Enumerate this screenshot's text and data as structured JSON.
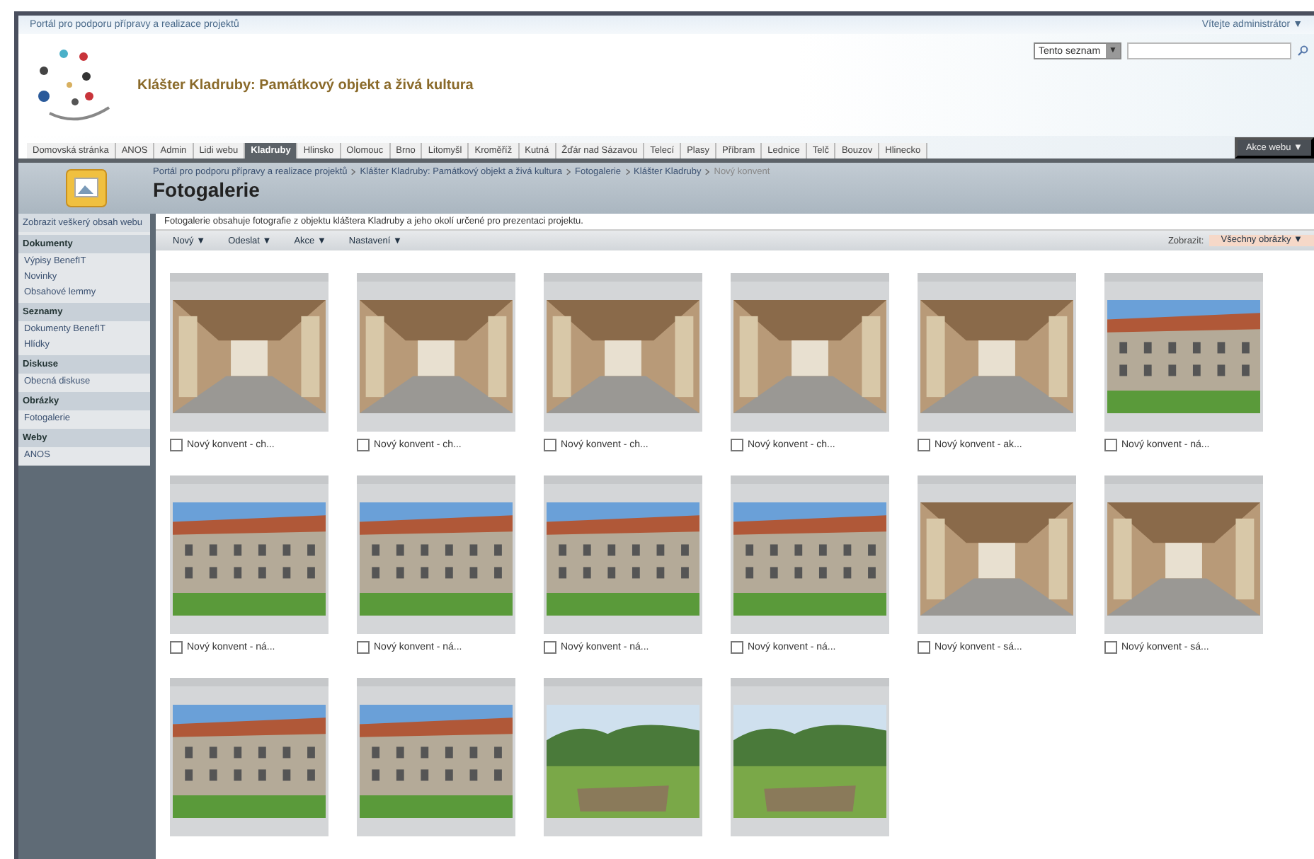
{
  "top_bar": {
    "site": "Portál pro podporu přípravy a realizace projektů",
    "user": "Vítejte administrátor ▼"
  },
  "search": {
    "scope": "Tento seznam",
    "button": "▼"
  },
  "header": {
    "title": "Klášter Kladruby: Památkový objekt a živá kultura"
  },
  "nav": [
    {
      "label": "Domovská stránka",
      "selected": false
    },
    {
      "label": "ANOS",
      "selected": false
    },
    {
      "label": "Admin",
      "selected": false
    },
    {
      "label": "Lidi webu",
      "selected": false
    },
    {
      "label": "Kladruby",
      "selected": true
    },
    {
      "label": "Hlinsko",
      "selected": false
    },
    {
      "label": "Olomouc",
      "selected": false
    },
    {
      "label": "Brno",
      "selected": false
    },
    {
      "label": "Litomyšl",
      "selected": false
    },
    {
      "label": "Kroměříž",
      "selected": false
    },
    {
      "label": "Kutná",
      "selected": false
    },
    {
      "label": "Žďár nad Sázavou",
      "selected": false
    },
    {
      "label": "Telecí",
      "selected": false
    },
    {
      "label": "Plasy",
      "selected": false
    },
    {
      "label": "Příbram",
      "selected": false
    },
    {
      "label": "Lednice",
      "selected": false
    },
    {
      "label": "Telč",
      "selected": false
    },
    {
      "label": "Bouzov",
      "selected": false
    },
    {
      "label": "Hlinecko",
      "selected": false
    }
  ],
  "site_actions": "Akce webu ▼",
  "breadcrumb": [
    "Portál pro podporu přípravy a realizace projektů",
    "Klášter Kladruby: Památkový objekt a živá kultura",
    "Fotogalerie",
    "Klášter Kladruby",
    "Nový konvent"
  ],
  "page_title": "Fotogalerie",
  "description": "Fotogalerie obsahuje fotografie z objektu kláštera Kladruby a jeho okolí určené pro prezentaci projektu.",
  "toolbar": [
    "Nový ▼",
    "Odeslat ▼",
    "Akce ▼",
    "Nastavení ▼"
  ],
  "view": {
    "label": "Zobrazit:",
    "value": "Všechny obrázky ▼"
  },
  "sidebar": {
    "all_content": "Zobrazit veškerý obsah webu",
    "sections": [
      {
        "heading": "Dokumenty",
        "items": [
          "Výpisy BenefIT",
          "Novinky",
          "Obsahové lemmy"
        ]
      },
      {
        "heading": "Seznamy",
        "items": [
          "Dokumenty BenefIT",
          "Hlídky"
        ]
      },
      {
        "heading": "Diskuse",
        "items": [
          "Obecná diskuse"
        ]
      },
      {
        "heading": "Obrázky",
        "items": [
          "Fotogalerie"
        ]
      },
      {
        "heading": "Weby",
        "items": [
          "ANOS"
        ]
      }
    ]
  },
  "photos": [
    {
      "kind": "interior",
      "caption": "Nový konvent - ch...",
      "checked": false
    },
    {
      "kind": "interior",
      "caption": "Nový konvent - ch...",
      "checked": false
    },
    {
      "kind": "interior",
      "caption": "Nový konvent - ch...",
      "checked": false
    },
    {
      "kind": "interior",
      "caption": "Nový konvent - ch...",
      "checked": false
    },
    {
      "kind": "interior",
      "caption": "Nový konvent - ak...",
      "checked": false
    },
    {
      "kind": "courtyard",
      "caption": "Nový konvent - ná...",
      "checked": false
    },
    {
      "kind": "courtyard",
      "caption": "Nový konvent - ná...",
      "checked": false
    },
    {
      "kind": "courtyard",
      "caption": "Nový konvent - ná...",
      "checked": false
    },
    {
      "kind": "courtyard",
      "caption": "Nový konvent - ná...",
      "checked": false
    },
    {
      "kind": "courtyard",
      "caption": "Nový konvent - ná...",
      "checked": false
    },
    {
      "kind": "interior",
      "caption": "Nový konvent - sá...",
      "checked": false
    },
    {
      "kind": "interior",
      "caption": "Nový konvent - sá...",
      "checked": false
    },
    {
      "kind": "courtyard"
    },
    {
      "kind": "courtyard"
    },
    {
      "kind": "landscape"
    },
    {
      "kind": "landscape"
    }
  ]
}
